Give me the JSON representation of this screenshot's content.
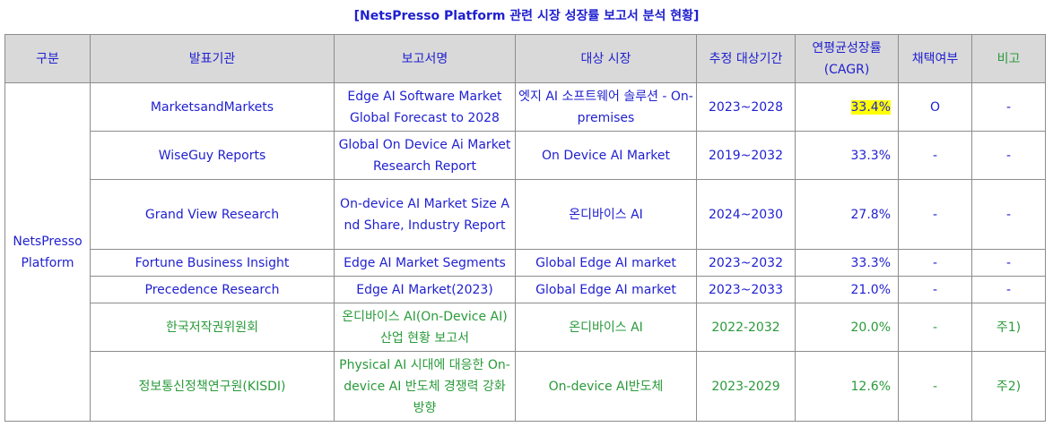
{
  "title": "[NetsPresso Platform 관련 시장 성장률 보고서 분석 현황]",
  "headers": [
    "구분",
    "발표기관",
    "보고서명",
    "대상 시장",
    "추정 대상기간",
    "연평균성장률 (CAGR)",
    "채택여부",
    "비고"
  ],
  "group_label": "NetsPresso Platform",
  "rows": [
    {
      "org": "MarketsandMarkets",
      "report": "Edge AI Software Market Global Forecast to 2028",
      "market": "엣지 AI 소프트웨어 솔루션 - On-premises",
      "period": "2023~2028",
      "cagr": "33.4%",
      "adopted": "O",
      "note": "-"
    },
    {
      "org": "WiseGuy Reports",
      "report": "Global On Device Ai Market Research Report",
      "market": "On Device AI Market",
      "period": "2019~2032",
      "cagr": "33.3%",
      "adopted": "-",
      "note": "-"
    },
    {
      "org": "Grand View Research",
      "report": "On-device AI Market Size And Share, Industry Report",
      "market": "온디바이스 AI",
      "period": "2024~2030",
      "cagr": "27.8%",
      "adopted": "-",
      "note": "-"
    },
    {
      "org": "Fortune Business Insight",
      "report": "Edge AI Market Segments",
      "market": "Global Edge AI market",
      "period": "2023~2032",
      "cagr": "33.3%",
      "adopted": "-",
      "note": "-"
    },
    {
      "org": "Precedence Research",
      "report": "Edge AI Market(2023)",
      "market": "Global Edge AI market",
      "period": "2023~2033",
      "cagr": "21.0%",
      "adopted": "-",
      "note": "-"
    },
    {
      "org": "한국저작권위원회",
      "report": "온디바이스 AI(On-Device AI) 산업 현황 보고서",
      "market": "온디바이스 AI",
      "period": "2022-2032",
      "cagr": "20.0%",
      "adopted": "-",
      "note": "주1)"
    },
    {
      "org": "정보통신정책연구원(KISDI)",
      "report": "Physical AI 시대에 대응한 On-device AI 반도체 경쟁력 강화 방향",
      "market": "On-device AI반도체",
      "period": "2023-2029",
      "cagr": "12.6%",
      "adopted": "-",
      "note": "주2)"
    }
  ]
}
